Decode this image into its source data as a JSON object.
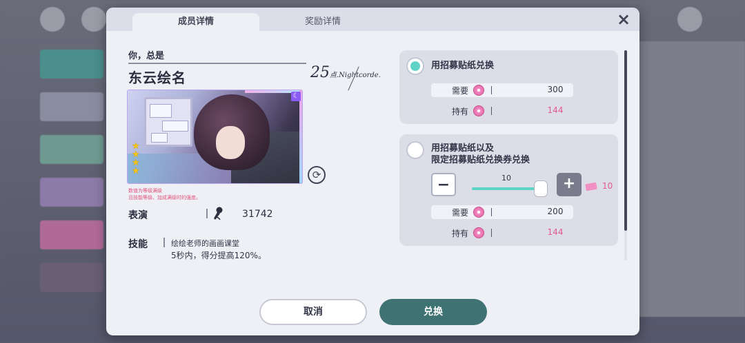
{
  "tabs": [
    {
      "label": "成员详情",
      "active": true
    },
    {
      "label": "奖励详情",
      "active": false
    }
  ],
  "card": {
    "subtitle": "你，总是",
    "name": "东云绘名",
    "unit_logo_number": "25",
    "unit_logo_text": "点.Nightcorde.",
    "rarity_stars": 4,
    "note_line1": "数值为等级满级",
    "note_line2": "且技能等级、加成满级时的强度。",
    "performance_label": "表演",
    "performance_value": "31742",
    "skill_label": "技能",
    "skill_name": "绘绘老师的画画课堂",
    "skill_desc": "5秒内，得分提高120%。"
  },
  "options": [
    {
      "title": "用招募贴纸兑换",
      "selected": true,
      "need_label": "需要",
      "need_value": "300",
      "have_label": "持有",
      "have_value": "144"
    },
    {
      "title_line1": "用招募贴纸以及",
      "title_line2": "限定招募贴纸兑换券兑换",
      "selected": false,
      "slider_value": "10",
      "slider_fraction": 1.0,
      "ticket_count": "10",
      "need_label": "需要",
      "need_value": "200",
      "have_label": "持有",
      "have_value": "144",
      "minus_label": "−",
      "plus_label": "+"
    }
  ],
  "buttons": {
    "cancel": "取消",
    "confirm": "兑换"
  },
  "icons": {
    "close": "×",
    "refresh": "⟳",
    "attribute": "☾",
    "star": "★"
  },
  "colors": {
    "accent_teal": "#5fd4c6",
    "confirm_button": "#3f7273",
    "pink_value": "#e35a8e"
  }
}
